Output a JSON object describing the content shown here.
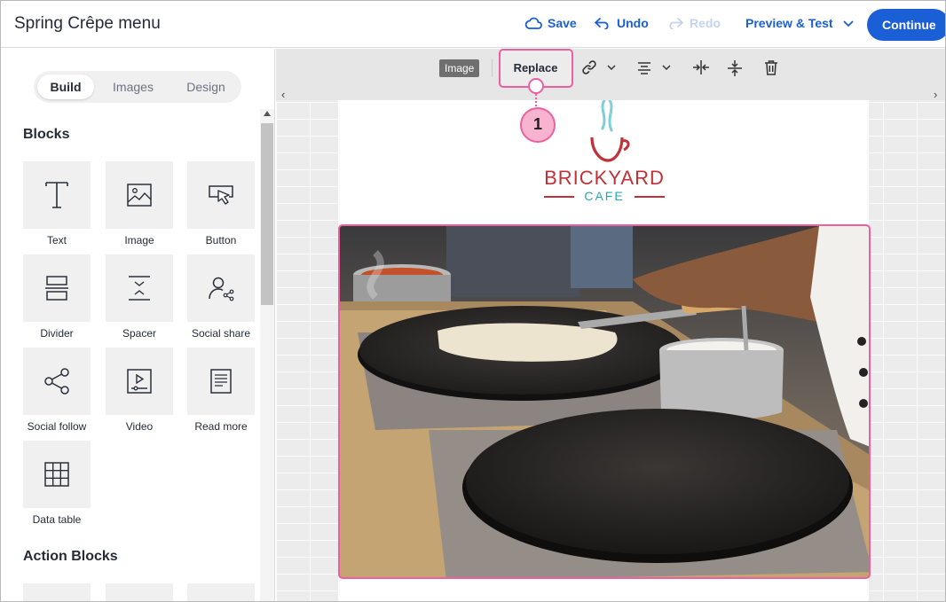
{
  "header": {
    "title": "Spring Crêpe menu",
    "save_label": "Save",
    "undo_label": "Undo",
    "redo_label": "Redo",
    "preview_label": "Preview & Test",
    "continue_label": "Continue"
  },
  "sidebar": {
    "tabs": [
      "Build",
      "Images",
      "Design"
    ],
    "active_tab": "Build",
    "blocks_title": "Blocks",
    "blocks": [
      {
        "label": "Text",
        "icon": "text-icon"
      },
      {
        "label": "Image",
        "icon": "image-icon"
      },
      {
        "label": "Button",
        "icon": "button-icon"
      },
      {
        "label": "Divider",
        "icon": "divider-icon"
      },
      {
        "label": "Spacer",
        "icon": "spacer-icon"
      },
      {
        "label": "Social share",
        "icon": "social-share-icon"
      },
      {
        "label": "Social follow",
        "icon": "social-follow-icon"
      },
      {
        "label": "Video",
        "icon": "video-icon"
      },
      {
        "label": "Read more",
        "icon": "read-more-icon"
      },
      {
        "label": "Data table",
        "icon": "data-table-icon"
      }
    ],
    "action_blocks_title": "Action Blocks"
  },
  "toolbar": {
    "badge": "Image",
    "replace_label": "Replace",
    "callout_number": "1"
  },
  "email": {
    "logo_text": "BRICKYARD",
    "logo_sub": "CAFE"
  },
  "colors": {
    "accent": "#1b5fd6",
    "highlight": "#ee5fa0",
    "logo_red": "#c2303a",
    "logo_teal": "#2aa6b4"
  }
}
